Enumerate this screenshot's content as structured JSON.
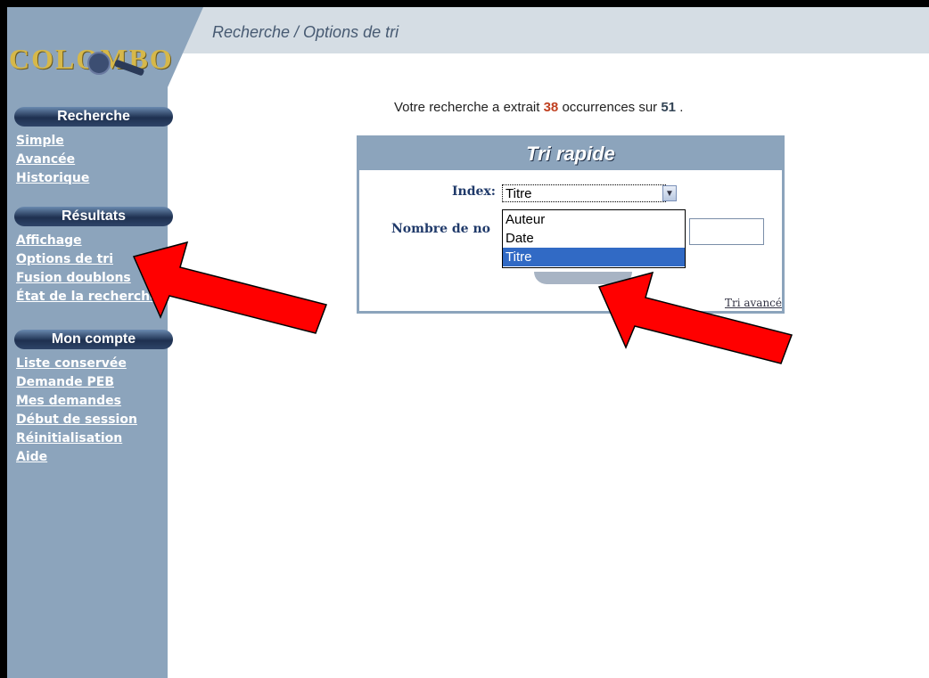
{
  "header": {
    "logo_text": "COLOMBO",
    "page_title": "Recherche / Options de tri"
  },
  "sidebar": {
    "sections": [
      {
        "title": "Recherche",
        "items": [
          "Simple",
          "Avancée",
          "Historique"
        ]
      },
      {
        "title": "Résultats",
        "items": [
          "Affichage",
          "Options de tri",
          "Fusion doublons",
          "État de la recherche"
        ]
      },
      {
        "title": "Mon compte",
        "items": [
          "Liste conservée",
          "Demande PEB",
          "Mes demandes",
          "Début de session",
          "Réinitialisation",
          "Aide"
        ]
      }
    ]
  },
  "summary": {
    "prefix": "Votre recherche a extrait",
    "count": "38",
    "middle": "occurrences sur",
    "total": "51",
    "suffix": "."
  },
  "tri_rapide": {
    "title": "Tri rapide",
    "index_label": "Index:",
    "index_value": "Titre",
    "options": [
      "Auteur",
      "Date",
      "Titre"
    ],
    "selected_option": "Titre",
    "nombre_label": "Nombre de no",
    "advanced_link": "Tri avancé"
  },
  "colors": {
    "sidebar_bg": "#8ca4bc",
    "pill_dark": "#1e3050",
    "highlight": "#316ac5",
    "arrow": "#ff0000"
  }
}
